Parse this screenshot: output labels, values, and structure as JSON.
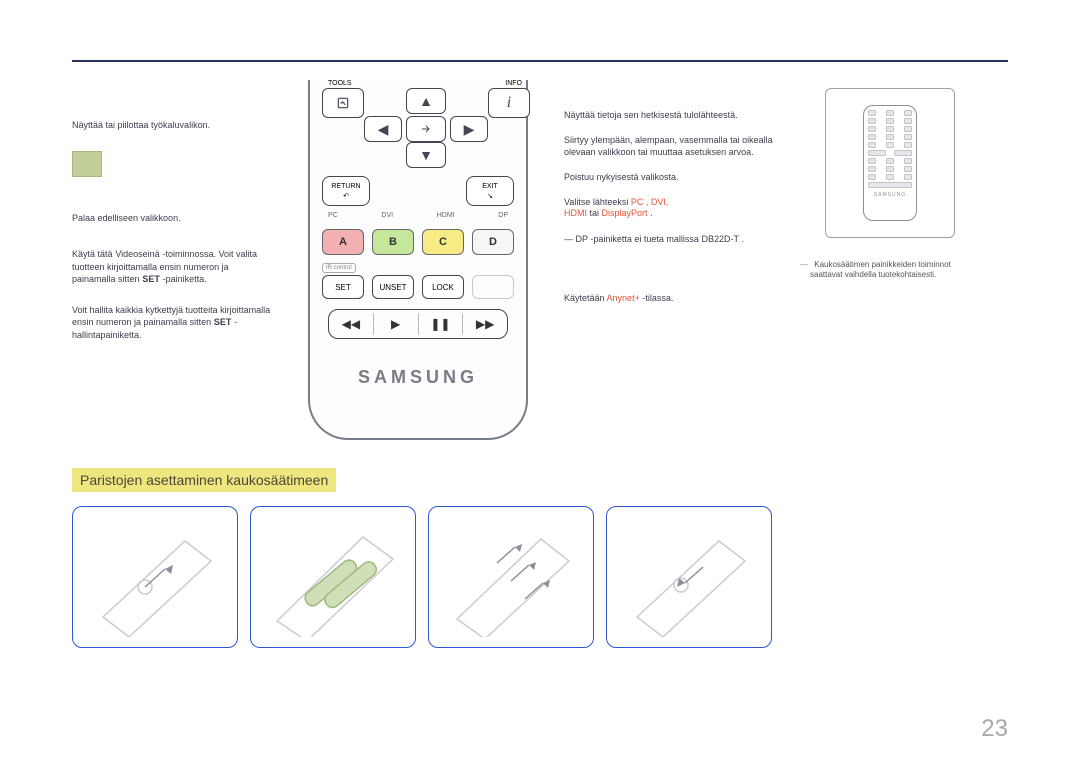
{
  "page_number": "23",
  "section_title": "Paristojen asettaminen kaukosäätimeen",
  "left": {
    "block1": "Näyttää tai piilottaa työkaluvalikon.",
    "block2": "Palaa edelliseen valikkoon.",
    "block3_prefix": "Käytä tätä",
    "block3_red": "Videoseinä",
    "block3_mid": "-toiminnossa. Voit valita tuotteen kirjoittamalla ensin numeron ja painamalla sitten",
    "block3_set": "SET",
    "block3_after": "-painiketta.",
    "block4_prefix": "Voit hallita kaikkia kytkettyjä tuotteita kirjoittamalla ensin numeron ja painamalla sitten",
    "block4_set": "SET",
    "block4_after": "-hallintapainiketta."
  },
  "remote": {
    "tools": "TOOLS",
    "info": "INFO",
    "return": "RETURN",
    "exit": "EXIT",
    "pc": "PC",
    "dvi": "DVI",
    "hdmi": "HDMI",
    "dp": "DP",
    "A": "A",
    "B": "B",
    "C": "C",
    "D": "D",
    "ir": "IR control",
    "set": "SET",
    "unset": "UNSET",
    "lock": "LOCK",
    "brand": "SAMSUNG"
  },
  "right": {
    "r1": "Näyttää tietoja sen hetkisestä tulolähteestä.",
    "r2": "Siirtyy ylempään, alempaan, vasemmalla tai oikealla olevaan valikkoon tai muuttaa asetuksen arvoa.",
    "r3": "Poistuu nykyisestä valikosta.",
    "r4_a": "Valitse lähteeksi ",
    "r4_pc": "PC",
    "r4_dvi": ", DVI,",
    "r4_hdmi": "HDMI",
    "r4_or": " tai ",
    "r4_dport": "DisplayPort",
    "r4_end": ".",
    "r5_a": "―",
    "r5_b": "DP",
    "r5_c": "-painiketta ei tueta mallissa",
    "r5_d": "DB22D-T",
    "r5_e": ".",
    "r6_a": "Käytetään ",
    "r6_anynet": "Anynet+",
    "r6_b": "-tilassa."
  },
  "aside": {
    "brand": "SAMSUNG",
    "note_a": "Kaukosäätimen painikkeiden toiminnot saattavat vaihdella tuotekohtaisesti."
  },
  "battery_panels": [
    "",
    "",
    "",
    ""
  ]
}
